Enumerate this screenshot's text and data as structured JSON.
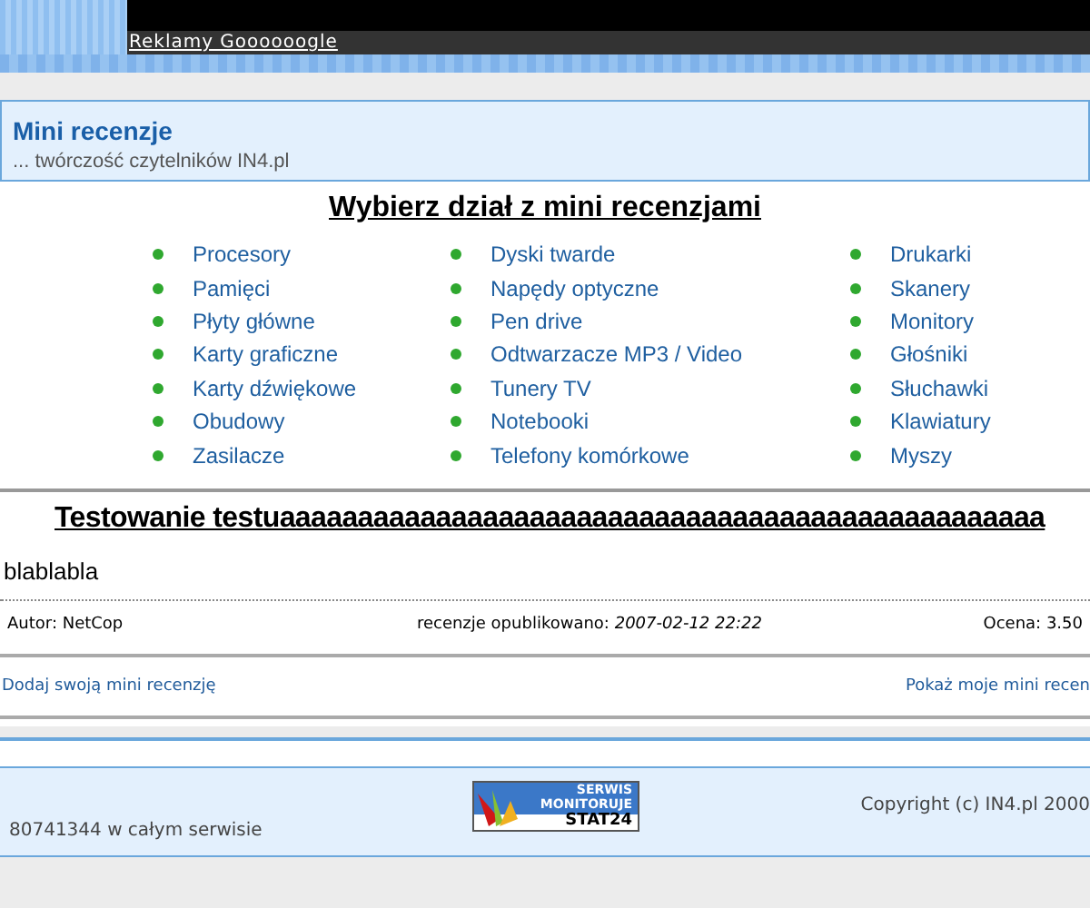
{
  "top_bar": {
    "ad_link": "Reklamy Goooooogle"
  },
  "header": {
    "title": "Mini recenzje",
    "subtitle": "... twórczość czytelników IN4.pl"
  },
  "sections": {
    "heading": "Wybierz dział z mini recenzjami",
    "columns": [
      [
        "Procesory",
        "Pamięci",
        "Płyty główne",
        "Karty graficzne",
        "Karty dźwiękowe",
        "Obudowy",
        "Zasilacze"
      ],
      [
        "Dyski twarde",
        "Napędy optyczne",
        "Pen drive",
        "Odtwarzacze MP3 / Video",
        "Tunery TV",
        "Notebooki",
        "Telefony komórkowe"
      ],
      [
        "Drukarki",
        "Skanery",
        "Monitory",
        "Głośniki",
        "Słuchawki",
        "Klawiatury",
        "Myszy"
      ]
    ]
  },
  "review": {
    "title": "Testowanie testuaaaaaaaaaaaaaaaaaaaaaaaaaaaaaaaaaaaaaaaaaaaaaaaaa",
    "body": "blablabla",
    "author": "Autor: NetCop",
    "published_label": "recenzje opublikowano:",
    "published_date": "2007-02-12 22:22",
    "rating": "Ocena: 3.50"
  },
  "actions": {
    "add_link": "Dodaj swoją mini recenzję",
    "my_link": "Pokaż moje mini recen"
  },
  "footer": {
    "counter": "80741344 w całym serwisie",
    "badge": {
      "line1": "SERWIS",
      "line2": "MONITORUJE",
      "line3": "STAT24"
    },
    "copyright": "Copyright (c) IN4.pl 2000"
  }
}
